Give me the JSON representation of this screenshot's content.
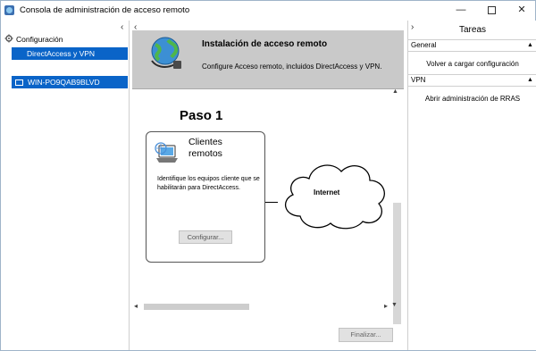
{
  "window": {
    "title": "Consola de administración de acceso remoto",
    "minimize_glyph": "—",
    "close_glyph": "✕"
  },
  "tree": {
    "root_label": "Configuración",
    "selected_item": "DirectAccess y VPN",
    "server_label": "WIN-PO9QAB9BLVD",
    "collapse_glyph": "‹"
  },
  "banner": {
    "title": "Instalación de acceso remoto",
    "subtitle": "Configure Acceso remoto, incluidos DirectAccess y VPN.",
    "icon": "globe-icon"
  },
  "wizard": {
    "step_title": "Paso 1",
    "card_title_line1": "Clientes",
    "card_title_line2": "remotos",
    "card_description": "Identifique los equipos cliente que se habilitarán para DirectAccess.",
    "configure_label": "Configurar...",
    "cloud_label": "Internet",
    "finish_label": "Finalizar..."
  },
  "tasks": {
    "title": "Tareas",
    "collapse_glyph": "›",
    "sections": [
      {
        "label": "General",
        "actions": [
          "Volver a cargar configuración"
        ]
      },
      {
        "label": "VPN",
        "actions": [
          "Abrir administración de RRAS"
        ]
      }
    ]
  },
  "scroll": {
    "up": "▲",
    "down": "▼",
    "left": "◂",
    "right": "▸",
    "collapse_up": "▲"
  },
  "colors": {
    "selection": "#0a64c8",
    "banner_bg": "#c9c9c9",
    "button_bg": "#e1e1e1"
  }
}
